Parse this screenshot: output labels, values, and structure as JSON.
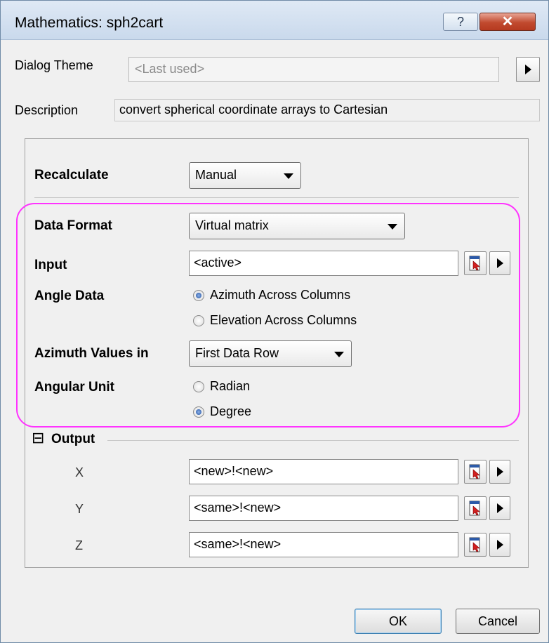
{
  "window": {
    "title": "Mathematics: sph2cart",
    "help_label": "?",
    "close_label": "✕"
  },
  "dialog_theme": {
    "label": "Dialog Theme",
    "value": "<Last used>"
  },
  "description": {
    "label": "Description",
    "value": "convert spherical coordinate arrays to Cartesian"
  },
  "recalculate": {
    "label": "Recalculate",
    "value": "Manual"
  },
  "data_format": {
    "label": "Data Format",
    "value": "Virtual matrix"
  },
  "input": {
    "label": "Input",
    "value": "<active>"
  },
  "angle_data": {
    "label": "Angle Data",
    "options": [
      "Azimuth Across Columns",
      "Elevation Across Columns"
    ],
    "selected": "Azimuth Across Columns"
  },
  "azimuth_values_in": {
    "label": "Azimuth Values in",
    "value": "First Data Row"
  },
  "angular_unit": {
    "label": "Angular Unit",
    "options": [
      "Radian",
      "Degree"
    ],
    "selected": "Degree"
  },
  "output": {
    "toggle": "⊟",
    "label": "Output",
    "rows": [
      {
        "label": "X",
        "value": "<new>!<new>"
      },
      {
        "label": "Y",
        "value": "<same>!<new>"
      },
      {
        "label": "Z",
        "value": "<same>!<new>"
      }
    ]
  },
  "buttons": {
    "ok": "OK",
    "cancel": "Cancel"
  },
  "colors": {
    "highlight": "#ff33ff",
    "close_button": "#c14a2f"
  }
}
